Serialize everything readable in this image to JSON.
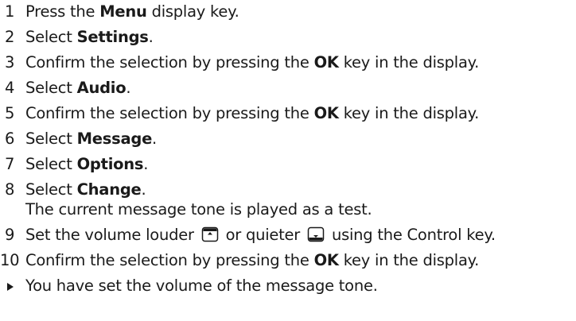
{
  "steps": [
    {
      "num": "1",
      "pre": "Press the ",
      "bold": "Menu",
      "post": " display key."
    },
    {
      "num": "2",
      "pre": "Select ",
      "bold": "Settings",
      "post": "."
    },
    {
      "num": "3",
      "pre": "Confirm the selection by pressing the ",
      "bold": "OK",
      "post": " key in the display."
    },
    {
      "num": "4",
      "pre": "Select ",
      "bold": "Audio",
      "post": "."
    },
    {
      "num": "5",
      "pre": "Confirm the selection by pressing the ",
      "bold": "OK",
      "post": " key in the display."
    },
    {
      "num": "6",
      "pre": "Select ",
      "bold": "Message",
      "post": "."
    },
    {
      "num": "7",
      "pre": "Select ",
      "bold": "Options",
      "post": "."
    },
    {
      "num": "8",
      "pre": "Select ",
      "bold": "Change",
      "post": ".",
      "continuation": "The current message tone is played as a test."
    },
    {
      "num": "9",
      "pre": "Set the volume louder ",
      "mid": " or quieter ",
      "post": " using the Control key.",
      "icon_up": "control-key-up-icon",
      "icon_down": "control-key-down-icon"
    },
    {
      "num": "10",
      "pre": "Confirm the selection by pressing the ",
      "bold": "OK",
      "post": " key in the display."
    }
  ],
  "result": {
    "icon": "result-arrow-icon",
    "text": "You have set the volume of the message tone."
  }
}
